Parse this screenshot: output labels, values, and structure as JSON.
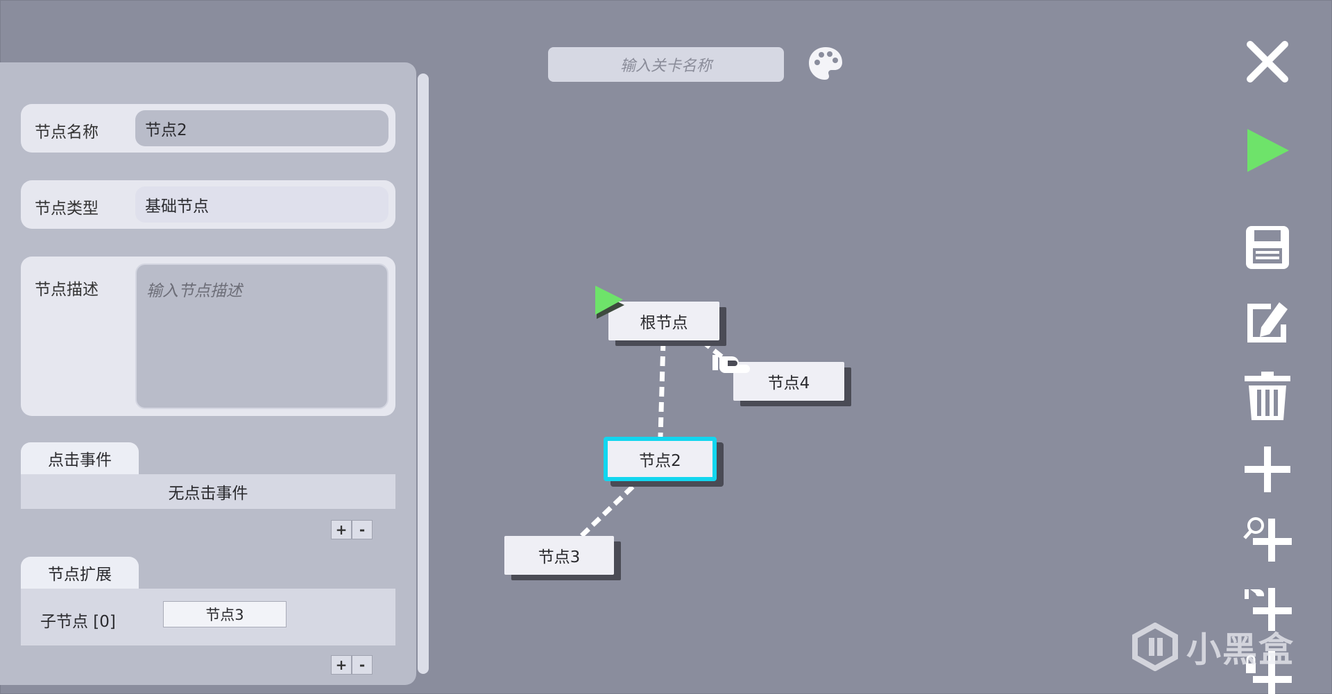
{
  "panel": {
    "name_label": "节点名称",
    "name_value": "节点2",
    "type_label": "节点类型",
    "type_value": "基础节点",
    "desc_label": "节点描述",
    "desc_placeholder": "输入节点描述",
    "click_tab": "点击事件",
    "click_empty": "无点击事件",
    "ext_tab": "节点扩展",
    "child_label": "子节点 [0]",
    "child_value": "节点3",
    "plus": "+",
    "minus": "-"
  },
  "top": {
    "level_placeholder": "输入关卡名称"
  },
  "graph": {
    "nodes": {
      "root": "根节点",
      "node4": "节点4",
      "node2": "节点2",
      "node3": "节点3"
    },
    "selected_color": "#12d6ef",
    "start_color": "#6ee36a"
  },
  "toolbar": {
    "icons": [
      "close-icon",
      "play-icon",
      "save-icon",
      "edit-icon",
      "trash-icon",
      "add-icon",
      "search-add-icon",
      "link-add-icon",
      "lock-add-icon"
    ]
  },
  "watermark": {
    "text": "小黑盒"
  }
}
